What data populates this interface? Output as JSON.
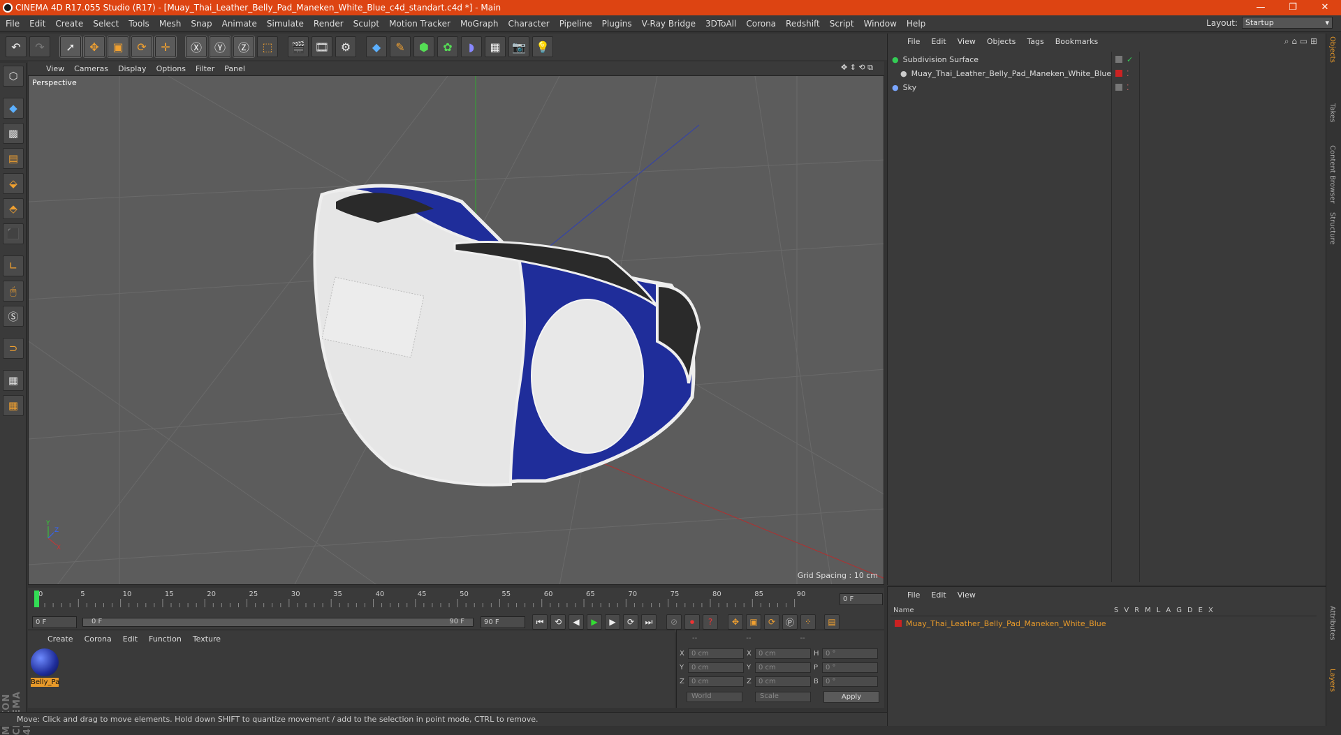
{
  "window": {
    "title": "CINEMA 4D R17.055 Studio (R17) - [Muay_Thai_Leather_Belly_Pad_Maneken_White_Blue_c4d_standart.c4d *] - Main",
    "controls": {
      "minimize": "—",
      "restore": "❐",
      "close": "✕"
    }
  },
  "menubar": {
    "items": [
      "File",
      "Edit",
      "Create",
      "Select",
      "Tools",
      "Mesh",
      "Snap",
      "Animate",
      "Simulate",
      "Render",
      "Sculpt",
      "Motion Tracker",
      "MoGraph",
      "Character",
      "Pipeline",
      "Plugins",
      "V-Ray Bridge",
      "3DToAll",
      "Corona",
      "Redshift",
      "Script",
      "Window",
      "Help"
    ],
    "layout_label": "Layout:",
    "layout_value": "Startup"
  },
  "viewport": {
    "menu": [
      "View",
      "Cameras",
      "Display",
      "Options",
      "Filter",
      "Panel"
    ],
    "label": "Perspective",
    "grid_spacing": "Grid Spacing : 10 cm",
    "axis_y": "Y",
    "axis_z": "Z",
    "axis_x": "X"
  },
  "timeline": {
    "ticks": [
      "0",
      "5",
      "10",
      "15",
      "20",
      "25",
      "30",
      "35",
      "40",
      "45",
      "50",
      "55",
      "60",
      "65",
      "70",
      "75",
      "80",
      "85",
      "90"
    ],
    "end_frame_field": "0 F",
    "start_field": "0 F",
    "range_left": "0 F",
    "range_right": "90 F",
    "end_field": "90 F"
  },
  "material_panel": {
    "menu": [
      "Create",
      "Corona",
      "Edit",
      "Function",
      "Texture"
    ],
    "material_name": "Belly_Pa"
  },
  "coordinates": {
    "headers": [
      "--",
      "--",
      "--"
    ],
    "rows": [
      {
        "a": "X",
        "av": "0 cm",
        "b": "X",
        "bv": "0 cm",
        "c": "H",
        "cv": "0 °"
      },
      {
        "a": "Y",
        "av": "0 cm",
        "b": "Y",
        "bv": "0 cm",
        "c": "P",
        "cv": "0 °"
      },
      {
        "a": "Z",
        "av": "0 cm",
        "b": "Z",
        "bv": "0 cm",
        "c": "B",
        "cv": "0 °"
      }
    ],
    "world": "World",
    "scale": "Scale",
    "apply": "Apply"
  },
  "objects_panel": {
    "menu": [
      "File",
      "Edit",
      "View",
      "Objects",
      "Tags",
      "Bookmarks"
    ],
    "items": [
      {
        "name": "Subdivision Surface",
        "indent": 0
      },
      {
        "name": "Muay_Thai_Leather_Belly_Pad_Maneken_White_Blue",
        "indent": 1
      },
      {
        "name": "Sky",
        "indent": 0
      }
    ]
  },
  "layers_panel": {
    "menu": [
      "File",
      "Edit",
      "View"
    ],
    "col_name": "Name",
    "col_flags": [
      "S",
      "V",
      "R",
      "M",
      "L",
      "A",
      "G",
      "D",
      "E",
      "X"
    ],
    "row": "Muay_Thai_Leather_Belly_Pad_Maneken_White_Blue"
  },
  "right_tabs": [
    "Objects",
    "Takes",
    "Content Browser",
    "Structure",
    "Attributes",
    "Layers"
  ],
  "status": "Move: Click and drag to move elements. Hold down SHIFT to quantize movement / add to the selection in point mode, CTRL to remove.",
  "brand": "MAXON CINEMA 4D",
  "colors": {
    "title_bar": "#dd4412",
    "accent_orange": "#e89a2a",
    "layer_red": "#cc2222",
    "pad_blue": "#1f2d9a"
  }
}
